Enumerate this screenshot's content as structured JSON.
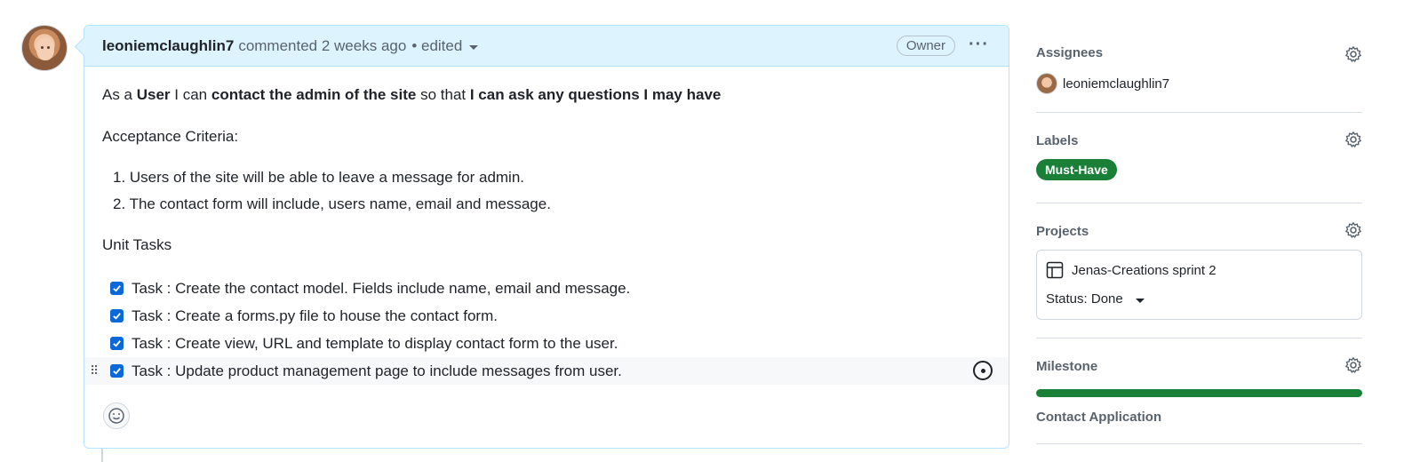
{
  "comment": {
    "author": "leoniemclaughlin7",
    "meta": "commented 2 weeks ago",
    "edited": "• edited",
    "role_badge": "Owner",
    "more_icon": "kebab-horizontal-icon",
    "story": {
      "p1": "As a ",
      "b1": "User",
      "p2": " I can ",
      "b2": "contact the admin of the site",
      "p3": " so that ",
      "b3": "I can ask any questions I may have"
    },
    "acceptance_heading": "Acceptance Criteria:",
    "acceptance_items": [
      "1. Users of the site will be able to leave a message for admin.",
      "2. The contact form will include, users name, email and message."
    ],
    "unit_heading": "Unit Tasks",
    "tasks": [
      {
        "text": "Task : Create the contact model. Fields include name, email and message.",
        "checked": true
      },
      {
        "text": "Task : Create a forms.py file to house the contact form.",
        "checked": true
      },
      {
        "text": "Task : Create view, URL and template to display contact form to the user.",
        "checked": true
      },
      {
        "text": "Task : Update product management page to include messages from user.",
        "checked": true
      }
    ],
    "emoji_icon": "smiley-icon"
  },
  "sidebar": {
    "assignees": {
      "title": "Assignees",
      "user": "leoniemclaughlin7"
    },
    "labels": {
      "title": "Labels",
      "items": [
        {
          "name": "Must-Have",
          "color": "#1a7f37"
        }
      ]
    },
    "projects": {
      "title": "Projects",
      "project_name": "Jenas-Creations sprint 2",
      "status": "Status: Done"
    },
    "milestone": {
      "title": "Milestone",
      "name": "Contact Application",
      "progress": 1.0,
      "color": "#1a7f37"
    }
  },
  "colors": {
    "accent": "#0969da",
    "header_bg": "#ddf4ff",
    "header_border": "#b6e3ff"
  }
}
